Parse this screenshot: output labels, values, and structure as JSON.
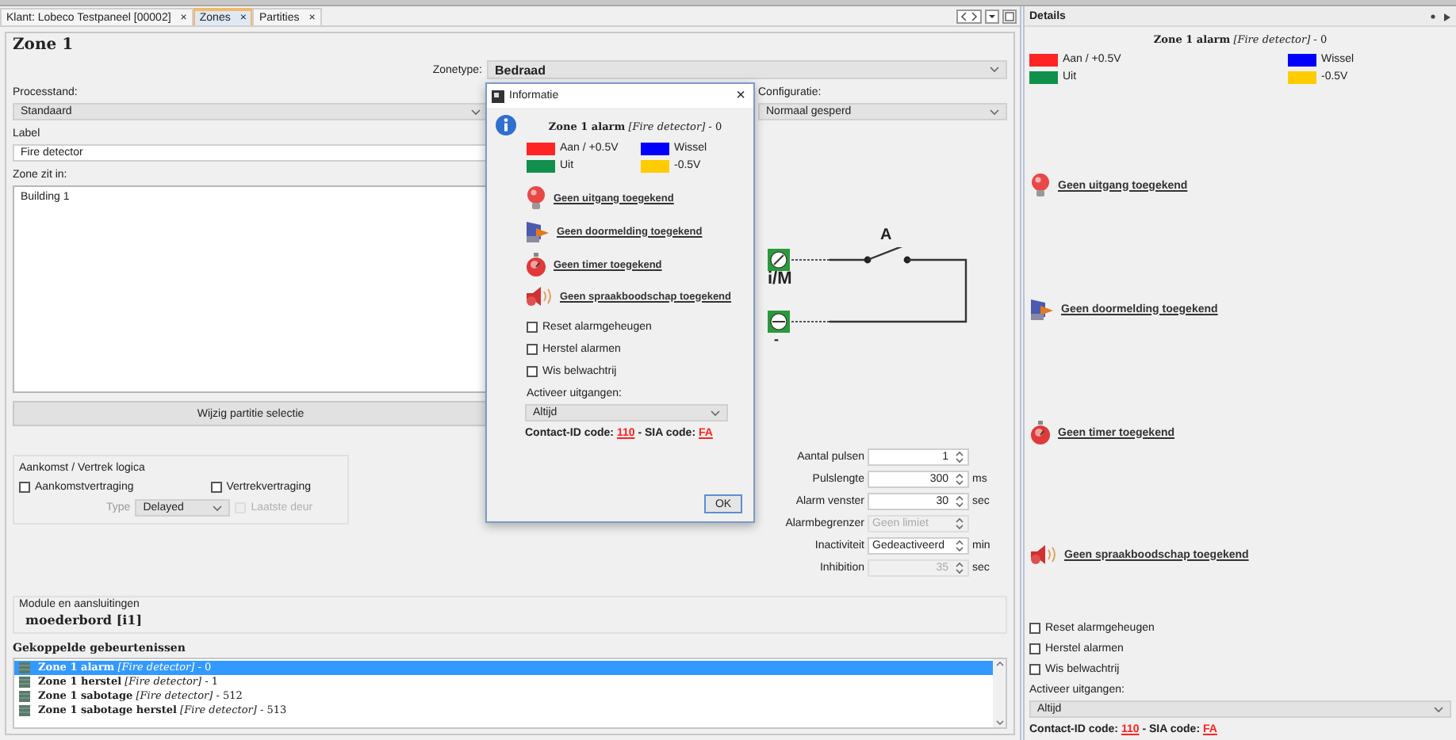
{
  "tabs": [
    {
      "label": "Klant: Lobeco Testpaneel [00002]",
      "close": "×",
      "selected": false
    },
    {
      "label": "Zones",
      "close": "×",
      "selected": true
    },
    {
      "label": "Partities",
      "close": "×",
      "selected": false
    }
  ],
  "zone": {
    "title": "Zone 1",
    "zonetype_label": "Zonetype:",
    "zonetype": "Bedraad",
    "processtand_label": "Processtand:",
    "processtand": "Standaard",
    "configuratie_label": "Configuratie:",
    "configuratie": "Normaal gesperd",
    "label_label": "Label",
    "label_value": "Fire detector",
    "zone_in_label": "Zone zit in:",
    "zone_in_value": "Building 1",
    "partition_button": "Wijzig partitie selectie"
  },
  "diagram": {
    "terminal_1": "i/M",
    "terminal_2": "-",
    "switch": "A"
  },
  "arrival": {
    "title": "Aankomst / Vertrek logica",
    "checks": [
      {
        "label": "Aankomstvertraging",
        "checked": false
      },
      {
        "label": "Vertrekvertraging",
        "checked": false
      }
    ],
    "type_label": "Type",
    "type_value": "Delayed",
    "last_door": {
      "label": "Laatste deur",
      "checked": false,
      "disabled": true
    }
  },
  "parameters": [
    {
      "label": "Aantal pulsen",
      "value": "1",
      "disabled": false,
      "kind": "number"
    },
    {
      "label": "Pulslengte",
      "value": "300",
      "unit": "ms",
      "disabled": false,
      "kind": "number"
    },
    {
      "label": "Alarm venster",
      "value": "30",
      "unit": "sec",
      "disabled": false,
      "kind": "number"
    },
    {
      "label": "Alarmbegrenzer",
      "value": "Geen limiet",
      "disabled": true,
      "kind": "text"
    },
    {
      "label": "Inactiviteit",
      "value": "Gedeactiveerd",
      "unit": "min",
      "disabled": false,
      "kind": "text"
    },
    {
      "label": "Inhibition",
      "value": "35",
      "unit": "sec",
      "disabled": true,
      "kind": "number"
    }
  ],
  "module": {
    "title": "Module en aansluitingen",
    "value": "moederbord [i1]"
  },
  "events": {
    "title": "Gekoppelde gebeurtenissen",
    "rows": [
      {
        "text": "**Zone 1 alarm** *[Fire detector]* - 0",
        "selected": true
      },
      {
        "text": "**Zone 1 herstel** *[Fire detector]* - 1",
        "selected": false
      },
      {
        "text": "**Zone 1 sabotage** *[Fire detector]* - 512",
        "selected": false
      },
      {
        "text": "**Zone 1 sabotage herstel** *[Fire detector]* - 513",
        "selected": false
      }
    ]
  },
  "details": {
    "title": "Details",
    "heading": "**Zone 1 alarm** *[Fire detector]* - 0",
    "legend": [
      {
        "label": "Aan / +0.5V",
        "color": "#ff2424"
      },
      {
        "label": "Wissel",
        "color": "#0000ff"
      },
      {
        "label": "Uit",
        "color": "#10904a"
      },
      {
        "label": "-0.5V",
        "color": "#ffcc00"
      }
    ],
    "links": [
      {
        "kind": "output",
        "label": "Geen uitgang toegekend"
      },
      {
        "kind": "report",
        "label": "Geen doormelding toegekend"
      },
      {
        "kind": "timer",
        "label": "Geen timer toegekend"
      },
      {
        "kind": "speech",
        "label": "Geen spraakboodschap toegekend"
      }
    ],
    "checks": [
      {
        "label": "Reset alarmgeheugen",
        "checked": false
      },
      {
        "label": "Herstel alarmen",
        "checked": false
      },
      {
        "label": "Wis belwachtrij",
        "checked": false
      }
    ],
    "activate_label": "Activeer uitgangen:",
    "activate_value": "Altijd",
    "codes": {
      "contact_id_label": "Contact-ID code:",
      "contact_id": "110",
      "separator": "-",
      "sia_label": "SIA code:",
      "sia": "FA"
    }
  },
  "dialog": {
    "title": "Informatie",
    "close": "×",
    "heading": "**Zone 1 alarm** *[Fire detector]* - 0",
    "legend": [
      {
        "label": "Aan / +0.5V",
        "color": "#ff2424"
      },
      {
        "label": "Wissel",
        "color": "#0000ff"
      },
      {
        "label": "Uit",
        "color": "#10904a"
      },
      {
        "label": "-0.5V",
        "color": "#ffcc00"
      }
    ],
    "links": [
      {
        "kind": "output",
        "label": "Geen uitgang toegekend"
      },
      {
        "kind": "report",
        "label": "Geen doormelding toegekend"
      },
      {
        "kind": "timer",
        "label": "Geen timer toegekend"
      },
      {
        "kind": "speech",
        "label": "Geen spraakboodschap toegekend"
      }
    ],
    "checks": [
      {
        "label": "Reset alarmgeheugen",
        "checked": false
      },
      {
        "label": "Herstel alarmen",
        "checked": false
      },
      {
        "label": "Wis belwachtrij",
        "checked": false
      }
    ],
    "activate_label": "Activeer uitgangen:",
    "activate_value": "Altijd",
    "codes": {
      "contact_id_label": "Contact-ID code:",
      "contact_id": "110",
      "separator": "-",
      "sia_label": "SIA code:",
      "sia": "FA"
    },
    "ok": "OK"
  }
}
